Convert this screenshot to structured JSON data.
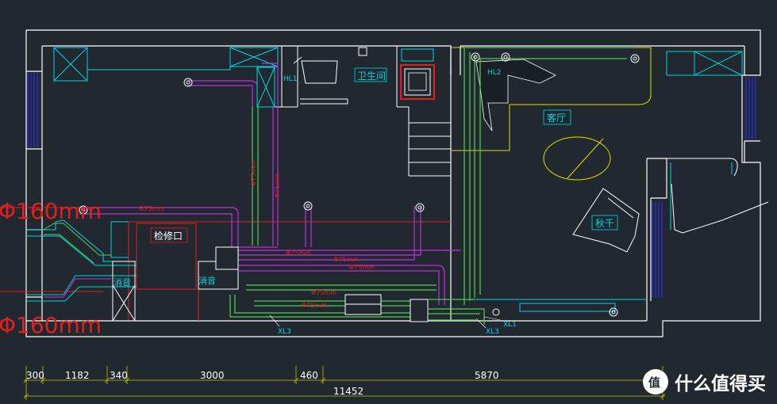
{
  "rooms": {
    "bathroom": "卫生间",
    "living_room": "客厅",
    "swing": "秋千",
    "access_panel": "检修口"
  },
  "equipment": {
    "silencer_left": "消音",
    "silencer_right": "消音"
  },
  "pipe_sizes": {
    "big_top": "Φ160mm",
    "big_bottom": "Φ160mm",
    "d75_left": "Φ75mm",
    "d75_mid1": "Φ75mm",
    "d75_mid2": "Φ75mm",
    "d75_mid3": "Φ75mm",
    "d75_vert1": "Φ75mm",
    "d75_vert2": "Φ75mm",
    "d75_bottom1": "Φ75mm",
    "d75_bottom2": "Φ75mm"
  },
  "tags": {
    "hl1": "HL1",
    "hl2": "HL2",
    "xl3_left": "XL3",
    "xl3_right": "XL3",
    "xl1": "XL1"
  },
  "dimensions": {
    "segments": [
      "300",
      "1182",
      "340",
      "3000",
      "460",
      "5870"
    ],
    "total": "11452"
  },
  "watermark": {
    "text": "什么值得买",
    "mark": "值"
  },
  "colors": {
    "background": "#212830",
    "wall": "#ffffff",
    "supply_pipe": "#c030e0",
    "exhaust_pipe": "#50d050",
    "cyan": "#00d6e0",
    "red": "#e02020",
    "yellow": "#e0e000",
    "dimension": "#b8c400",
    "window": "#2020c0"
  }
}
